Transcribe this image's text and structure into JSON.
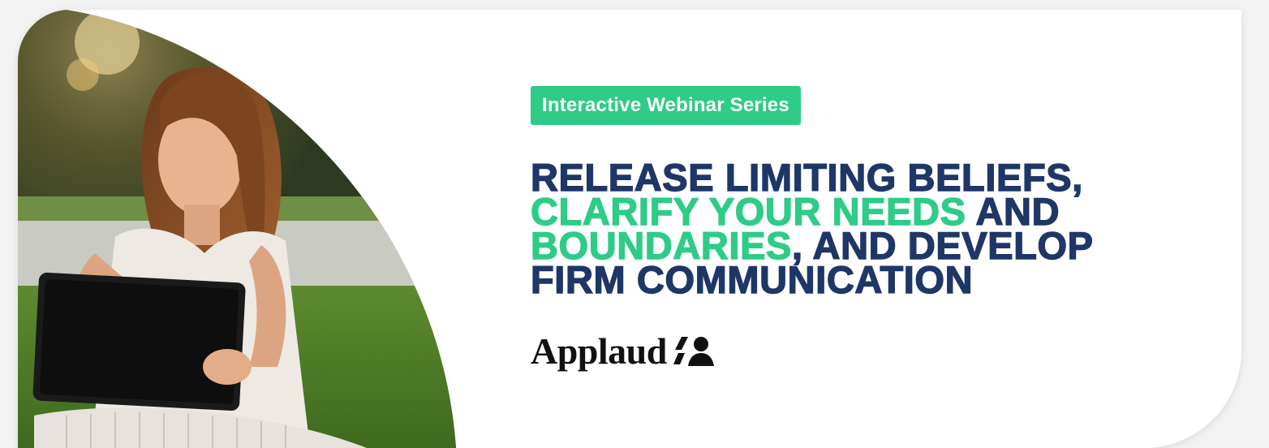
{
  "tag": {
    "label": "Interactive Webinar Series"
  },
  "headline": {
    "segments": [
      {
        "text": "RELEASE LIMITING BELIEFS,",
        "accent": false
      },
      {
        "text": "CLARIFY YOUR NEEDS",
        "accent": true
      },
      {
        "text": " AND",
        "accent": false
      },
      {
        "text": "BOUNDARIES",
        "accent": true
      },
      {
        "text": ", AND DEVELOP",
        "accent": false
      },
      {
        "text": "FIRM COMMUNICATION",
        "accent": false
      }
    ]
  },
  "logo": {
    "wordmark": "Applaud",
    "icon": "two-people-icon"
  },
  "photo": {
    "description_icon": "woman-with-tablet-photo"
  },
  "colors": {
    "navy": "#1e3767",
    "green": "#2ecc86"
  }
}
